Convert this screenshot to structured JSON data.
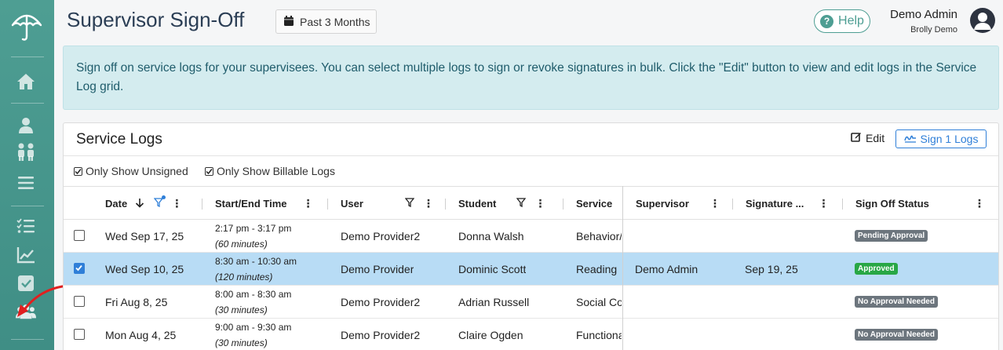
{
  "header": {
    "title": "Supervisor Sign-Off",
    "period_label": "Past 3 Months",
    "help_label": "Help",
    "user_name": "Demo Admin",
    "user_org": "Brolly Demo"
  },
  "banner": {
    "text": "Sign off on service logs for your supervisees. You can select multiple logs to sign or revoke signatures in bulk. Click the \"Edit\" button to view and edit logs in the Service Log grid."
  },
  "card": {
    "title": "Service Logs",
    "edit_label": "Edit",
    "sign_label": "Sign 1 Logs",
    "filter_unsigned": "Only Show Unsigned",
    "filter_billable": "Only Show Billable Logs"
  },
  "columns": {
    "date": "Date",
    "time": "Start/End Time",
    "user": "User",
    "student": "Student",
    "service": "Service",
    "supervisor": "Supervisor",
    "signature": "Signature ...",
    "status": "Sign Off Status"
  },
  "rows": [
    {
      "date": "Wed Sep 17, 25",
      "time": "2:17 pm - 3:17 pm",
      "duration": "(60 minutes)",
      "user": "Demo Provider2",
      "student": "Donna Walsh",
      "service": "Behavior/",
      "supervisor": "",
      "signature": "",
      "status": "Pending Approval",
      "checked": false
    },
    {
      "date": "Wed Sep 10, 25",
      "time": "8:30 am - 10:30 am",
      "duration": "(120 minutes)",
      "user": "Demo Provider",
      "student": "Dominic Scott",
      "service": "Reading",
      "supervisor": "Demo Admin",
      "signature": "Sep 19, 25",
      "status": "Approved",
      "checked": true
    },
    {
      "date": "Fri Aug 8, 25",
      "time": "8:00 am - 8:30 am",
      "duration": "(30 minutes)",
      "user": "Demo Provider2",
      "student": "Adrian Russell",
      "service": "Social Co",
      "supervisor": "",
      "signature": "",
      "status": "No Approval Needed",
      "checked": false
    },
    {
      "date": "Mon Aug 4, 25",
      "time": "9:00 am - 9:30 am",
      "duration": "(30 minutes)",
      "user": "Demo Provider2",
      "student": "Claire Ogden",
      "service": "Functiona",
      "supervisor": "",
      "signature": "",
      "status": "No Approval Needed",
      "checked": false
    }
  ],
  "colors": {
    "sidebar": "#4e9e93",
    "accent_blue": "#2f7fd8",
    "pending": "#6c757d",
    "approved": "#28a745",
    "no_approval": "#6c757d",
    "selected_row": "#b8dcf5",
    "annotation_arrow": "#e02020"
  },
  "icons": {
    "sidebar": [
      "umbrella-logo-icon",
      "home-icon",
      "user-icon",
      "students-icon",
      "menu-icon",
      "checklist-icon",
      "chart-icon",
      "check-square-icon",
      "users-icon"
    ]
  }
}
